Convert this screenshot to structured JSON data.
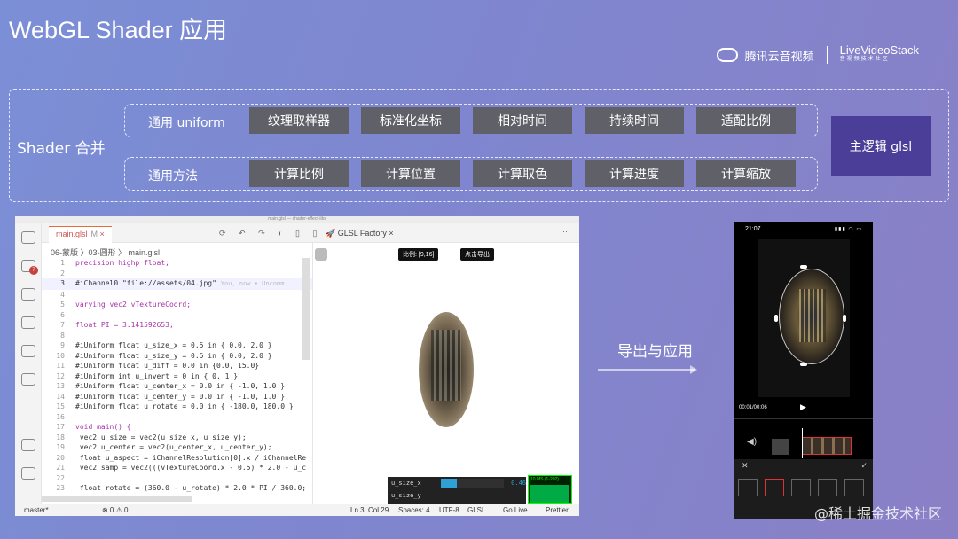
{
  "slide": {
    "title": "WebGL Shader 应用",
    "brand": {
      "name": "腾讯云音视频",
      "partner": "LiveVideoStack",
      "partner_sub": "音视频技术社区"
    },
    "merge_label": "Shader 合并",
    "rows": [
      {
        "label": "通用 uniform",
        "chips": [
          "纹理取样器",
          "标准化坐标",
          "相对时间",
          "持续时间",
          "适配比例"
        ]
      },
      {
        "label": "通用方法",
        "chips": [
          "计算比例",
          "计算位置",
          "计算取色",
          "计算进度",
          "计算缩放"
        ]
      }
    ],
    "main_box": "主逻辑 glsl",
    "arrow_label": "导出与应用",
    "watermark": "@稀土掘金技术社区"
  },
  "editor": {
    "window_title": "main.glsl — shader-effect-libs",
    "tab_file": "main.glsl",
    "tab_file_mark": "M",
    "tab_preview": "GLSL Factory",
    "tab_icons": "⟳ ↶ ↷ ◐ ▯ ▯",
    "breadcrumb": "06-蒙版 〉03-圆形 〉 main.glsl",
    "code": [
      {
        "n": "1",
        "t": "precision highp float;"
      },
      {
        "n": "2",
        "t": ""
      },
      {
        "n": "3",
        "t": "#iChannel0 \"file://assets/04.jpg\"",
        "hint": "You, now • Uncomm"
      },
      {
        "n": "4",
        "t": ""
      },
      {
        "n": "5",
        "t": "varying vec2 vTextureCoord;"
      },
      {
        "n": "6",
        "t": ""
      },
      {
        "n": "7",
        "t": "float PI = 3.141592653;"
      },
      {
        "n": "8",
        "t": ""
      },
      {
        "n": "9",
        "t": "#iUniform float u_size_x = 0.5 in { 0.0, 2.0 }"
      },
      {
        "n": "10",
        "t": "#iUniform float u_size_y = 0.5 in { 0.0, 2.0 }"
      },
      {
        "n": "11",
        "t": "#iUniform float u_diff = 0.0 in {0.0, 15.0}"
      },
      {
        "n": "12",
        "t": "#iUniform int u_invert = 0 in { 0, 1 }"
      },
      {
        "n": "13",
        "t": "#iUniform float u_center_x = 0.0 in { -1.0, 1.0 }"
      },
      {
        "n": "14",
        "t": "#iUniform float u_center_y = 0.0 in { -1.0, 1.0 }"
      },
      {
        "n": "15",
        "t": "#iUniform float u_rotate = 0.0 in { -180.0, 180.0 }"
      },
      {
        "n": "16",
        "t": ""
      },
      {
        "n": "17",
        "t": "void main() {"
      },
      {
        "n": "18",
        "t": "    vec2 u_size = vec2(u_size_x, u_size_y);"
      },
      {
        "n": "19",
        "t": "    vec2 u_center = vec2(u_center_x, u_center_y);"
      },
      {
        "n": "20",
        "t": "    float u_aspect = iChannelResolution[0].x / iChannelRe"
      },
      {
        "n": "21",
        "t": "    vec2 samp = vec2(((vTextureCoord.x - 0.5) * 2.0 - u_c"
      },
      {
        "n": "22",
        "t": ""
      },
      {
        "n": "23",
        "t": "    float rotate = (360.0 - u_rotate) * 2.0 * PI / 360.0;"
      }
    ],
    "preview_ratio_btn": "比例: [9,16]",
    "preview_export_btn": "点击导出",
    "gui": [
      {
        "name": "u_size_x",
        "value": "0.46"
      },
      {
        "name": "u_size_y",
        "value": ""
      }
    ],
    "stats": "10 MS (1-202)",
    "status": {
      "branch": "master*",
      "errors": "⊗ 0 ⚠ 0",
      "position": "Ln 3, Col 29",
      "spaces": "Spaces: 4",
      "encoding": "UTF-8",
      "language": "GLSL",
      "golive": "Go Live",
      "prettier": "Prettier"
    }
  },
  "phone": {
    "time": "21:07",
    "status_icons": "▮▮▮ ◠ ▭",
    "timecode": "00:01/00:06"
  }
}
